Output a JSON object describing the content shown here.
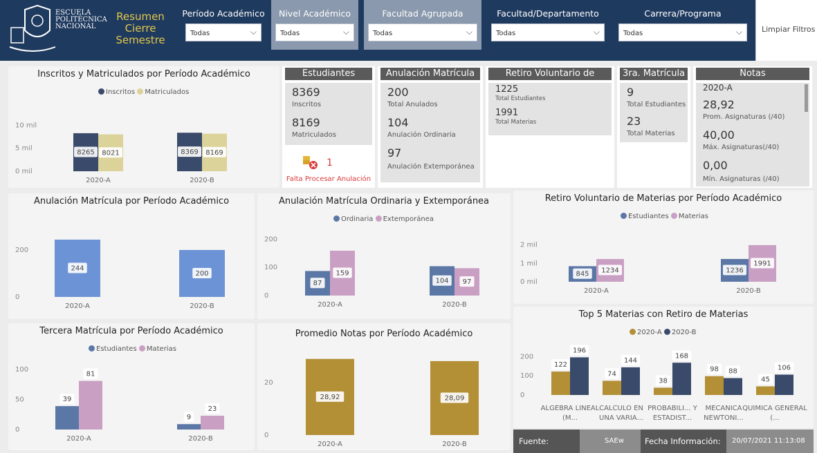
{
  "header": {
    "school_line1": "ESCUELA",
    "school_line2": "POLITÉCNICA",
    "school_line3": "NACIONAL",
    "report_title": "Resumen Cierre Semestre",
    "clear_filters": "Limpiar Filtros"
  },
  "filters": [
    {
      "label": "Período Académico",
      "value": "Todas"
    },
    {
      "label": "Nivel Académico",
      "value": "Todas"
    },
    {
      "label": "Facultad Agrupada",
      "value": "Todas"
    },
    {
      "label": "Facultad/Departamento",
      "value": "Todas"
    },
    {
      "label": "Carrera/Programa",
      "value": "Todas"
    }
  ],
  "cards": {
    "estudiantes": {
      "title": "Estudiantes",
      "v1": "8369",
      "l1": "Inscritos",
      "v2": "8169",
      "l2": "Matriculados",
      "alert_count": "1",
      "alert_text": "Falta Procesar Anulación"
    },
    "anulacion": {
      "title": "Anulación Matrícula",
      "v1": "200",
      "l1": "Total Anulados",
      "v2": "104",
      "l2": "Anulación Ordinaria",
      "v3": "97",
      "l3": "Anulación Extemporánea"
    },
    "retiro": {
      "title": "Retiro Voluntario de Materi...",
      "v1": "1225",
      "l1": "Total Estudiantes",
      "v2": "1991",
      "l2": "Total Materias"
    },
    "tercera": {
      "title": "3ra. Matrícula",
      "v1": "9",
      "l1": "Total Estudiantes",
      "v2": "23",
      "l2": "Total Materias"
    },
    "notas": {
      "title": "Notas",
      "period": "2020-A",
      "v1": "28,92",
      "l1": "Prom. Asignaturas (/40)",
      "v2": "40,00",
      "l2": "Máx. Asignaturas(/40)",
      "v3": "0,00",
      "l3": "Mín. Asignaturas (/40)"
    }
  },
  "colors": {
    "navy": "#3a4a6b",
    "cream": "#dcd39a",
    "blue": "#6b93d6",
    "steel": "#5b77a6",
    "pink": "#c9a0c4",
    "gold": "#b38f36",
    "header": "#1f3a5f"
  },
  "chart_data": [
    {
      "id": "inscritos",
      "type": "bar",
      "title": "Inscritos y Matriculados por Período Académico",
      "categories": [
        "2020-A",
        "2020-B"
      ],
      "series": [
        {
          "name": "Inscritos",
          "values": [
            8265,
            8369
          ]
        },
        {
          "name": "Matriculados",
          "values": [
            8021,
            8169
          ]
        }
      ],
      "yticks": [
        "0 mil",
        "5 mil",
        "10 mil"
      ],
      "ylim": [
        0,
        12000
      ]
    },
    {
      "id": "anulacion",
      "type": "bar",
      "title": "Anulación Matrícula por Período Académico",
      "categories": [
        "2020-A",
        "2020-B"
      ],
      "series": [
        {
          "name": "",
          "values": [
            244,
            200
          ]
        }
      ],
      "yticks": [
        "0",
        "200"
      ],
      "ylim": [
        0,
        300
      ]
    },
    {
      "id": "ordext",
      "type": "bar",
      "title": "Anulación Matrícula Ordinaria y Extemporánea",
      "categories": [
        "2020-A",
        "2020-B"
      ],
      "series": [
        {
          "name": "Ordinaria",
          "values": [
            87,
            104
          ]
        },
        {
          "name": "Extemporánea",
          "values": [
            159,
            97
          ]
        }
      ],
      "yticks": [
        "0",
        "100",
        "200"
      ],
      "ylim": [
        0,
        230
      ]
    },
    {
      "id": "retiro",
      "type": "bar",
      "title": "Retiro Voluntario de Materias por Período Académico",
      "categories": [
        "2020-A",
        "2020-B"
      ],
      "series": [
        {
          "name": "Estudiantes",
          "values": [
            845,
            1236
          ]
        },
        {
          "name": "Materias",
          "values": [
            1234,
            1991
          ]
        }
      ],
      "yticks": [
        "0 mil",
        "1 mil",
        "2 mil"
      ],
      "ylim": [
        0,
        2700
      ]
    },
    {
      "id": "tercera",
      "type": "bar",
      "title": "Tercera Matrícula por Período Académico",
      "categories": [
        "2020-A",
        "2020-B"
      ],
      "series": [
        {
          "name": "Estudiantes",
          "values": [
            39,
            9
          ]
        },
        {
          "name": "Materias",
          "values": [
            81,
            23
          ]
        }
      ],
      "yticks": [
        "0",
        "50",
        "100"
      ],
      "ylim": [
        0,
        115
      ]
    },
    {
      "id": "promedio",
      "type": "bar",
      "title": "Promedio Notas por Período Académico",
      "categories": [
        "2020-A",
        "2020-B"
      ],
      "series": [
        {
          "name": "",
          "values": [
            28.92,
            28.09
          ]
        }
      ],
      "labels": [
        "28,92",
        "28,09"
      ],
      "yticks": [
        "0",
        "20"
      ],
      "ylim": [
        0,
        32
      ]
    },
    {
      "id": "top5",
      "type": "bar",
      "title": "Top 5 Materias con Retiro de Materias",
      "categories": [
        "ALGEBRA LINEAL (M...",
        "CALCULO EN UNA VARIA...",
        "PROBABILI... Y ESTADIST...",
        "MECANICA NEWTONI...",
        "QUIMICA GENERAL (..."
      ],
      "series": [
        {
          "name": "2020-A",
          "values": [
            122,
            74,
            38,
            98,
            45
          ]
        },
        {
          "name": "2020-B",
          "values": [
            196,
            144,
            168,
            88,
            106
          ]
        }
      ],
      "yticks": [
        "0",
        "100",
        "200"
      ],
      "ylim": [
        0,
        230
      ]
    }
  ],
  "footer": {
    "source_label": "Fuente:",
    "source_value": "SAEw",
    "date_label": "Fecha Información:",
    "date_value": "20/07/2021 11:13:08"
  }
}
